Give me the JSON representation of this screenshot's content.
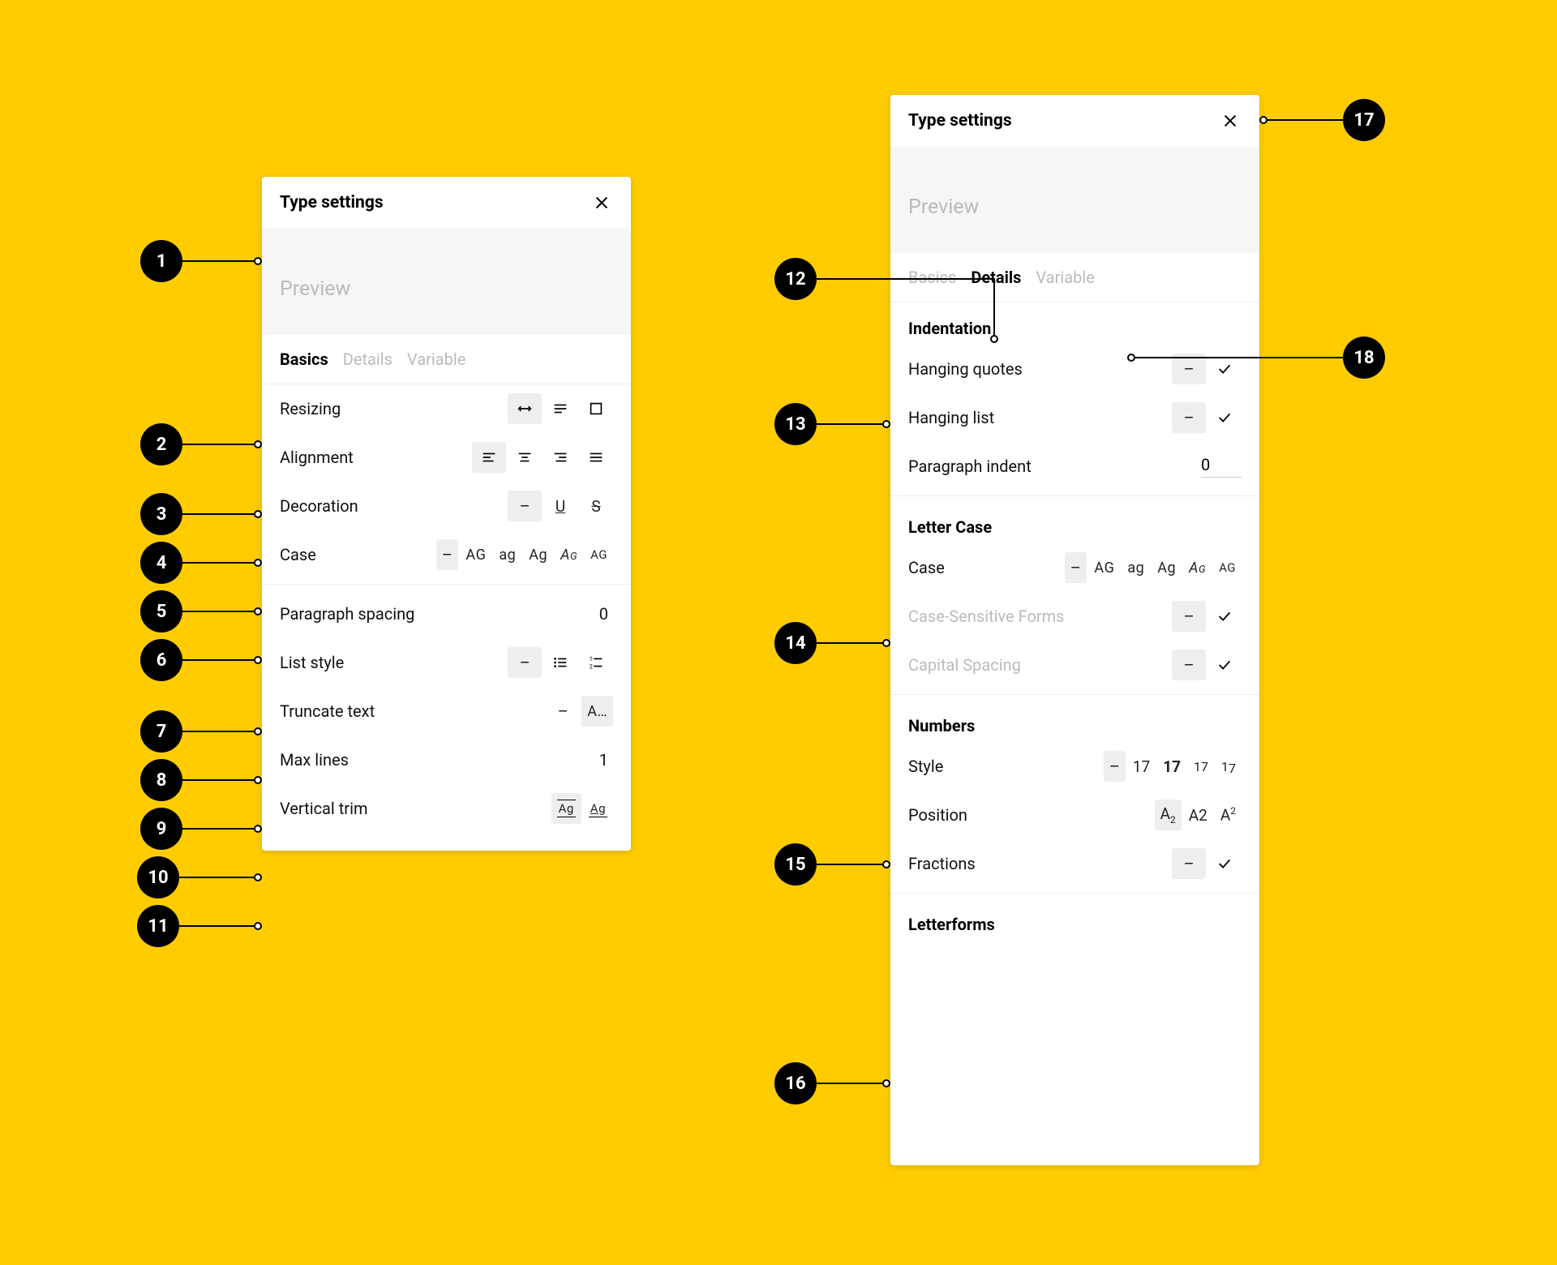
{
  "title": "Type settings",
  "preview_label": "Preview",
  "tabs": {
    "basics": "Basics",
    "details": "Details",
    "variable": "Variable"
  },
  "left_panel": {
    "resizing": {
      "label": "Resizing"
    },
    "alignment": {
      "label": "Alignment"
    },
    "decoration": {
      "label": "Decoration"
    },
    "case": {
      "label": "Case",
      "options": [
        "AG",
        "ag",
        "Ag",
        "AG",
        "AG"
      ]
    },
    "paragraph_spacing": {
      "label": "Paragraph spacing",
      "value": "0"
    },
    "list_style": {
      "label": "List style"
    },
    "truncate_text": {
      "label": "Truncate text",
      "value_option": "A…"
    },
    "max_lines": {
      "label": "Max lines",
      "value": "1"
    },
    "vertical_trim": {
      "label": "Vertical trim"
    }
  },
  "right_panel": {
    "indentation": {
      "title": "Indentation",
      "hanging_quotes": {
        "label": "Hanging quotes"
      },
      "hanging_list": {
        "label": "Hanging list"
      },
      "paragraph_indent": {
        "label": "Paragraph indent",
        "value": "0"
      }
    },
    "letter_case": {
      "title": "Letter Case",
      "case": {
        "label": "Case"
      },
      "case_sensitive_forms": {
        "label": "Case-Sensitive Forms"
      },
      "capital_spacing": {
        "label": "Capital Spacing"
      }
    },
    "numbers": {
      "title": "Numbers",
      "style": {
        "label": "Style",
        "options": [
          "17",
          "17",
          "17",
          "17"
        ]
      },
      "position": {
        "label": "Position",
        "options": [
          "A₂",
          "A2",
          "A²"
        ]
      },
      "fractions": {
        "label": "Fractions"
      }
    },
    "letterforms": {
      "title": "Letterforms"
    }
  },
  "callouts": {
    "c1": "1",
    "c2": "2",
    "c3": "3",
    "c4": "4",
    "c5": "5",
    "c6": "6",
    "c7": "7",
    "c8": "8",
    "c9": "9",
    "c10": "10",
    "c11": "11",
    "c12": "12",
    "c13": "13",
    "c14": "14",
    "c15": "15",
    "c16": "16",
    "c17": "17",
    "c18": "18"
  }
}
